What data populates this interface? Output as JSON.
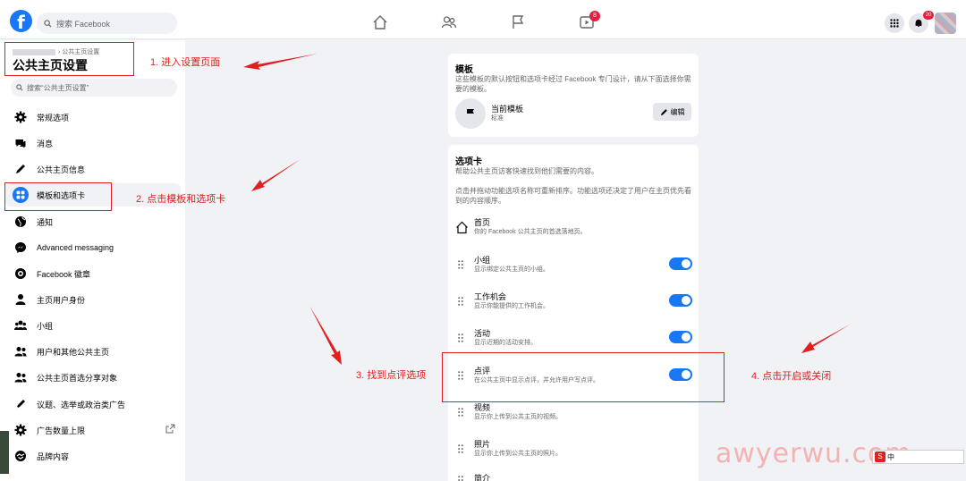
{
  "topbar": {
    "logo": "f",
    "search_placeholder": "搜索 Facebook",
    "nav_icons": [
      "home-icon",
      "friends-icon",
      "pages-flag-icon",
      "watch-icon"
    ],
    "watch_badge": "8",
    "notif_badge": "20"
  },
  "sidebar": {
    "breadcrumb": "› 公共主页设置",
    "title": "公共主页设置",
    "search_placeholder": "搜索“公共主页设置”",
    "items": [
      {
        "label": "常规选项",
        "icon": "gear-icon"
      },
      {
        "label": "消息",
        "icon": "chat-icon"
      },
      {
        "label": "公共主页信息",
        "icon": "pencil-icon"
      },
      {
        "label": "模板和选项卡",
        "icon": "grid-icon"
      },
      {
        "label": "通知",
        "icon": "globe-icon"
      },
      {
        "label": "Advanced messaging",
        "icon": "messenger-icon"
      },
      {
        "label": "Facebook 徽章",
        "icon": "badge-icon"
      },
      {
        "label": "主页用户身份",
        "icon": "person-icon"
      },
      {
        "label": "小组",
        "icon": "group-icon"
      },
      {
        "label": "用户和其他公共主页",
        "icon": "people-icon"
      },
      {
        "label": "公共主页首选分享对象",
        "icon": "people-icon"
      },
      {
        "label": "议题、选举或政治类广告",
        "icon": "pen-icon"
      },
      {
        "label": "广告数量上限",
        "icon": "gear-icon"
      },
      {
        "label": "品牌内容",
        "icon": "handshake-icon"
      }
    ]
  },
  "template_panel": {
    "title": "模板",
    "desc": "这些模板的默认按钮和选项卡经过 Facebook 专门设计，请从下面选择你需要的模板。",
    "current_label": "当前模板",
    "current_value": "标准",
    "edit_label": "编辑"
  },
  "tabs_panel": {
    "title": "选项卡",
    "desc1": "帮助公共主页访客快速找到他们需要的内容。",
    "desc2": "点击并拖动功能选项名称可重新排序。功能选项还决定了用户在主页优先看到的内容顺序。",
    "tabs": [
      {
        "name": "首页",
        "desc": "你的 Facebook 公共主页的首选落地页。",
        "toggle": null
      },
      {
        "name": "小组",
        "desc": "显示绑定公共主页的小组。",
        "toggle": true
      },
      {
        "name": "工作机会",
        "desc": "显示你能提供的工作机会。",
        "toggle": true
      },
      {
        "name": "活动",
        "desc": "显示近期的活动安排。",
        "toggle": true
      },
      {
        "name": "点评",
        "desc": "在公共主页中显示点评，并允许用户写点评。",
        "toggle": true
      },
      {
        "name": "视频",
        "desc": "显示你上传到公共主页的视频。",
        "toggle": null
      },
      {
        "name": "照片",
        "desc": "显示你上传到公共主页的照片。",
        "toggle": null
      },
      {
        "name": "简介",
        "desc": "",
        "toggle": null
      }
    ]
  },
  "annotations": [
    "1. 进入设置页面",
    "2. 点击模板和选项卡",
    "3. 找到点评选项",
    "4. 点击开启或关闭"
  ],
  "watermark": "awyerwu.com",
  "ime_bar": "中"
}
